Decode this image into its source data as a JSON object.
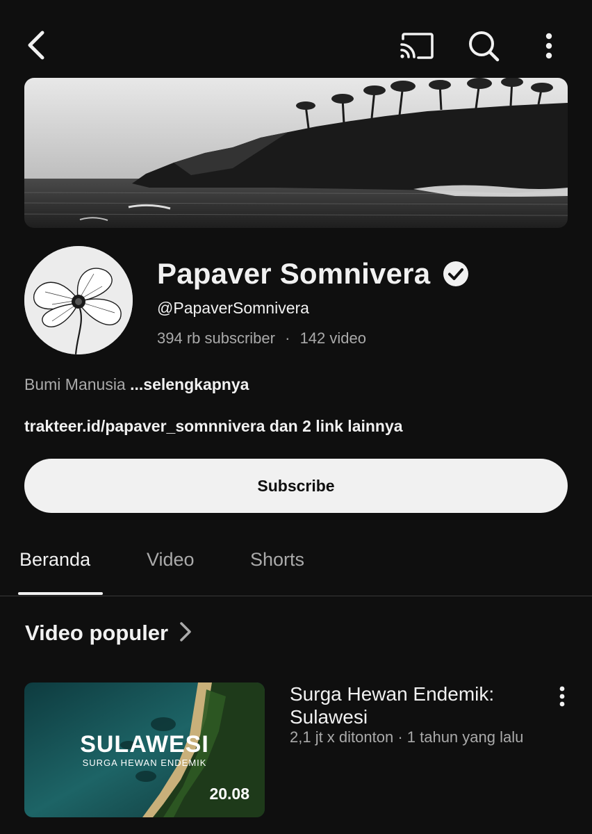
{
  "header": {
    "back_icon": "back-arrow-icon",
    "cast_icon": "cast-icon",
    "search_icon": "search-icon",
    "more_icon": "more-vertical-icon"
  },
  "channel": {
    "name": "Papaver Somnivera",
    "verified": true,
    "handle": "@PapaverSomnivera",
    "subscribers": "394 rb subscriber",
    "separator": "·",
    "video_count": "142 video",
    "description": "Bumi Manusia",
    "description_more": "...selengkapnya",
    "links": "trakteer.id/papaver_somnnivera dan 2 link lainnya"
  },
  "actions": {
    "subscribe_label": "Subscribe"
  },
  "tabs": [
    {
      "label": "Beranda",
      "active": true
    },
    {
      "label": "Video",
      "active": false
    },
    {
      "label": "Shorts",
      "active": false
    }
  ],
  "section": {
    "title": "Video populer"
  },
  "videos": [
    {
      "title": "Surga Hewan Endemik: Sulawesi",
      "meta": "2,1 jt x ditonton · 1 tahun yang lalu",
      "duration": "20.08",
      "thumb_title": "SULAWESI",
      "thumb_subtitle": "SURGA HEWAN ENDEMIK"
    }
  ],
  "colors": {
    "background": "#0f0f0f",
    "text_primary": "#f1f1f1",
    "text_secondary": "#aaaaaa",
    "subscribe_bg": "#f1f1f1"
  }
}
